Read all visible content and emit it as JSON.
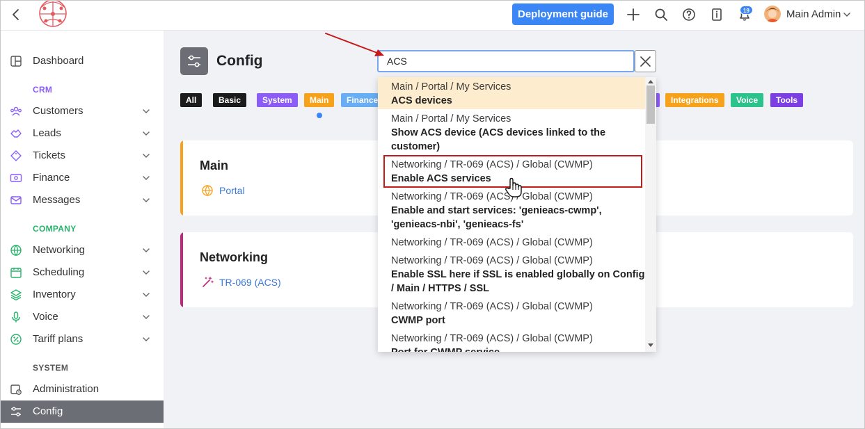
{
  "topbar": {
    "deploy_label": "Deployment guide",
    "notifications_count": "19",
    "user_name": "Main Admin"
  },
  "sidebar": {
    "items": [
      {
        "label": "Dashboard",
        "icon": "dashboard-icon"
      },
      {
        "label": "Customers",
        "icon": "customers-icon"
      },
      {
        "label": "Leads",
        "icon": "leads-icon"
      },
      {
        "label": "Tickets",
        "icon": "tickets-icon"
      },
      {
        "label": "Finance",
        "icon": "finance-icon"
      },
      {
        "label": "Messages",
        "icon": "messages-icon"
      },
      {
        "label": "Networking",
        "icon": "globe-icon"
      },
      {
        "label": "Scheduling",
        "icon": "calendar-icon"
      },
      {
        "label": "Inventory",
        "icon": "layers-icon"
      },
      {
        "label": "Voice",
        "icon": "microphone-icon"
      },
      {
        "label": "Tariff plans",
        "icon": "percent-icon"
      },
      {
        "label": "Administration",
        "icon": "administration-icon"
      },
      {
        "label": "Config",
        "icon": "sliders-icon"
      }
    ],
    "sections": {
      "crm": "CRM",
      "company": "COMPANY",
      "system": "SYSTEM"
    },
    "colors": {
      "crm": "#8b5cf6",
      "company": "#26b36b",
      "system": "#555555"
    }
  },
  "page": {
    "title": "Config"
  },
  "search": {
    "value": "ACS"
  },
  "chips": [
    {
      "label": "All",
      "color": "#1b1b1b"
    },
    {
      "label": "Basic",
      "color": "#1b1b1b"
    },
    {
      "label": "System",
      "color": "#8b5cf6"
    },
    {
      "label": "Main",
      "color": "#f7a21b"
    },
    {
      "label": "Finance",
      "color": "#67aef5"
    },
    {
      "label": "Integrations",
      "color": "#f7a21b"
    },
    {
      "label": "Voice",
      "color": "#2bc28b"
    },
    {
      "label": "Tools",
      "color": "#7b3fe4"
    }
  ],
  "cards": [
    {
      "title": "Main",
      "link": "Portal",
      "accent": "#f7a21b"
    },
    {
      "title": "Networking",
      "link": "TR-069 (ACS)",
      "accent": "#c0267a"
    }
  ],
  "dropdown": {
    "items": [
      {
        "path": "Main / Portal / My Services",
        "name": "ACS devices"
      },
      {
        "path": "Main / Portal / My Services",
        "name": "Show ACS device (ACS devices linked to the customer)"
      },
      {
        "path": "Networking / TR-069 (ACS) / Global (CWMP)",
        "name": "Enable ACS services"
      },
      {
        "path": "Networking / TR-069 (ACS) / Global (CWMP)",
        "name": "Enable and start services: 'genieacs-cwmp', 'genieacs-nbi', 'genieacs-fs'"
      },
      {
        "path": "Networking / TR-069 (ACS) / Global (CWMP)",
        "name": ""
      },
      {
        "path": "Networking / TR-069 (ACS) / Global (CWMP)",
        "name": "Enable SSL here if SSL is enabled globally on Config / Main / HTTPS / SSL"
      },
      {
        "path": "Networking / TR-069 (ACS) / Global (CWMP)",
        "name": "CWMP port"
      },
      {
        "path": "Networking / TR-069 (ACS) / Global (CWMP)",
        "name": "Port for CWMP service"
      }
    ]
  }
}
